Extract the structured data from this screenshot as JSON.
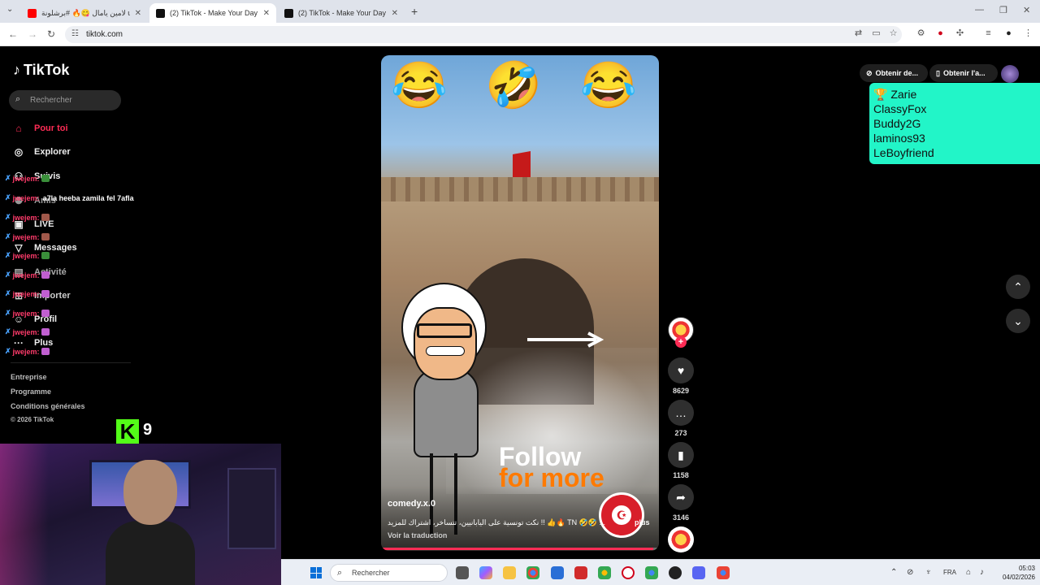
{
  "browser": {
    "tabs": [
      {
        "title": "لامين يامال 😋🔥 #برشلونة ube",
        "close": "✕",
        "favicon_color": "#ff0000"
      },
      {
        "title": "(2) TikTok - Make Your Day",
        "close": "✕",
        "favicon_color": "#111111"
      },
      {
        "title": "(2) TikTok - Make Your Day",
        "close": "✕",
        "favicon_color": "#111111"
      }
    ],
    "new_tab": "+",
    "url": "tiktok.com",
    "window_controls": [
      "—",
      "❐",
      "✕"
    ]
  },
  "tiktok": {
    "logo": "TikTok",
    "search_placeholder": "Rechercher",
    "nav": [
      {
        "label": "Pour toi",
        "icon": "home-icon"
      },
      {
        "label": "Explorer",
        "icon": "compass-icon"
      },
      {
        "label": "Suivis",
        "icon": "following-icon"
      },
      {
        "label": "Amis",
        "icon": "friends-icon"
      },
      {
        "label": "LIVE",
        "icon": "live-icon"
      },
      {
        "label": "Messages",
        "icon": "messages-icon"
      },
      {
        "label": "Activité",
        "icon": "activity-icon"
      },
      {
        "label": "Importer",
        "icon": "upload-icon"
      },
      {
        "label": "Profil",
        "icon": "profile-icon"
      },
      {
        "label": "Plus",
        "icon": "more-icon"
      }
    ],
    "footer": [
      "Entreprise",
      "Programme",
      "Conditions générales",
      "© 2026 TikTok"
    ],
    "top_buttons": [
      "Obtenir de...",
      "Obtenir l'a..."
    ]
  },
  "chat_overlay": [
    {
      "nick": "jwejem:",
      "msg": ""
    },
    {
      "nick": "jwejem:",
      "msg": "a7la heeba zamila fel 7afla"
    },
    {
      "nick": "jwejem:",
      "msg": ""
    },
    {
      "nick": "jwejem:",
      "msg": ""
    },
    {
      "nick": "jwejem:",
      "msg": ""
    },
    {
      "nick": "jwejem:",
      "msg": ""
    },
    {
      "nick": "jwejem:",
      "msg": ""
    },
    {
      "nick": "jwejem:",
      "msg": ""
    },
    {
      "nick": "jwejem:",
      "msg": ""
    },
    {
      "nick": "jwejem:",
      "msg": ""
    }
  ],
  "kick": {
    "logo": "K",
    "viewers": "9"
  },
  "video": {
    "emojis": [
      "😂",
      "🤣",
      "😂"
    ],
    "overlay_follow": "Follow",
    "overlay_more": "for more",
    "author": "comedy.x.0",
    "caption": "نكت تونسية على اليابانيين، تتساخر، اشتراك للمزيد !! 👍🔥 TN 🤣🤣 ...",
    "more_label": "plus",
    "translate": "Voir la traduction",
    "progress": 0.98
  },
  "actions": {
    "likes": "8629",
    "comments": "273",
    "saves": "1158",
    "shares": "3146",
    "follow_plus": "+"
  },
  "leaderboard": {
    "title_icon": "trophy-icon",
    "names": [
      "Zarie",
      "ClassyFox",
      "Buddy2G",
      "laminos93",
      "LeBoyfriend"
    ]
  },
  "taskbar": {
    "search_placeholder": "Rechercher",
    "language": "FRA",
    "time": "05:03",
    "date": "04/02/2026"
  }
}
